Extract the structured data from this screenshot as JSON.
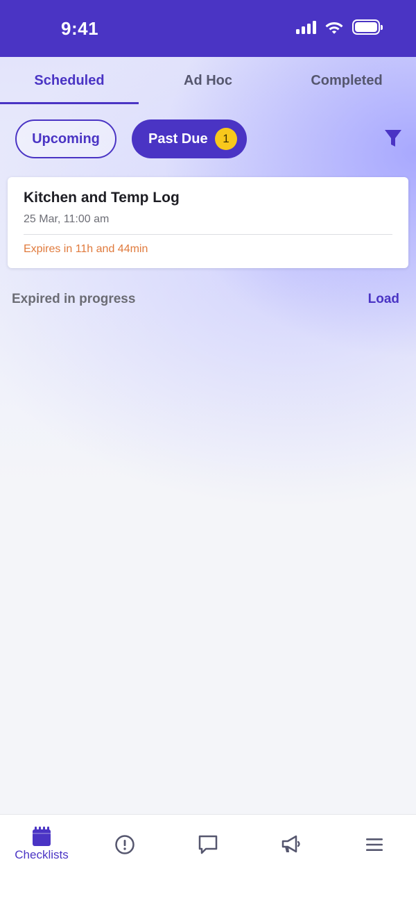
{
  "status_bar": {
    "time": "9:41"
  },
  "tabs": [
    {
      "label": "Scheduled",
      "active": true
    },
    {
      "label": "Ad Hoc",
      "active": false
    },
    {
      "label": "Completed",
      "active": false
    }
  ],
  "filters": {
    "upcoming_label": "Upcoming",
    "past_due_label": "Past Due",
    "past_due_count": "1",
    "filter_icon": "filter-funnel-icon"
  },
  "checklist_card": {
    "title": "Kitchen and Temp Log",
    "date": "25 Mar, 11:00 am",
    "expiry": "Expires in 11h and 44min"
  },
  "expired_section": {
    "label": "Expired in progress",
    "action_label": "Load"
  },
  "bottom_nav": {
    "items": [
      {
        "label": "Checklists",
        "icon": "calendar-icon",
        "active": true
      },
      {
        "label": "",
        "icon": "alert-circle-icon",
        "active": false
      },
      {
        "label": "",
        "icon": "chat-bubble-icon",
        "active": false
      },
      {
        "label": "",
        "icon": "megaphone-icon",
        "active": false
      },
      {
        "label": "",
        "icon": "menu-icon",
        "active": false
      }
    ]
  },
  "colors": {
    "primary": "#4a34c4",
    "badge": "#f8c81c",
    "expiry_text": "#e07a3c",
    "tab_inactive": "#55566e"
  }
}
